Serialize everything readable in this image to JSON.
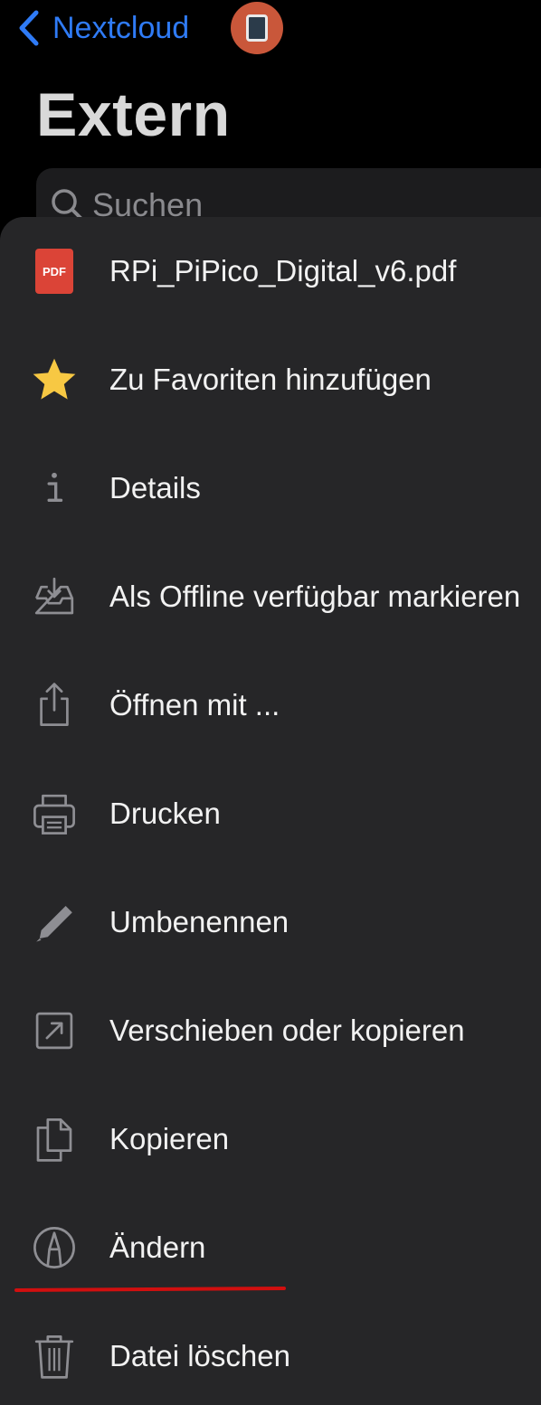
{
  "nav": {
    "back_label": "Nextcloud"
  },
  "page_title": "Extern",
  "search": {
    "placeholder": "Suchen"
  },
  "sheet": {
    "file_name": "RPi_PiPico_Digital_v6.pdf",
    "file_icon_text": "PDF",
    "items": [
      {
        "label": "Zu Favoriten hinzufügen",
        "icon": "star-icon"
      },
      {
        "label": "Details",
        "icon": "info-icon"
      },
      {
        "label": "Als Offline verfügbar markieren",
        "icon": "tray-download-icon"
      },
      {
        "label": "Öffnen mit ...",
        "icon": "share-icon"
      },
      {
        "label": "Drucken",
        "icon": "printer-icon"
      },
      {
        "label": "Umbenennen",
        "icon": "pencil-icon"
      },
      {
        "label": "Verschieben oder kopieren",
        "icon": "move-arrow-icon"
      },
      {
        "label": "Kopieren",
        "icon": "copy-icon"
      },
      {
        "label": "Ändern",
        "icon": "markup-icon"
      },
      {
        "label": "Datei löschen",
        "icon": "trash-icon"
      }
    ]
  },
  "colors": {
    "accent": "#2f7bf6",
    "sheet_bg": "#262628",
    "icon_gray": "#8e8e93",
    "star": "#f7c843",
    "pdf_red": "#db4437",
    "annotation_red": "#d10f0f"
  }
}
